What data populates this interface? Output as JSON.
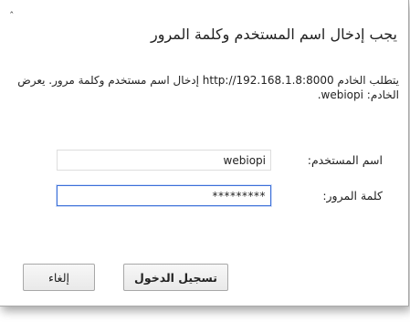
{
  "dialog": {
    "close_glyph": "ʿ",
    "title": "يجب إدخال اسم المستخدم وكلمة المرور",
    "message": "يتطلب الخادم http://192.168.1.8:8000 إدخال اسم مستخدم وكلمة مرور. يعرض الخادم: webiopi.",
    "username_label": "اسم المستخدم:",
    "username_value": "webiopi",
    "password_label": "كلمة المرور:",
    "password_value": "*********",
    "login_button": "تسجيل الدخول",
    "cancel_button": "إلغاء"
  },
  "colors": {
    "focus_border": "#3b6fd8",
    "button_border": "#a8a8a8"
  }
}
